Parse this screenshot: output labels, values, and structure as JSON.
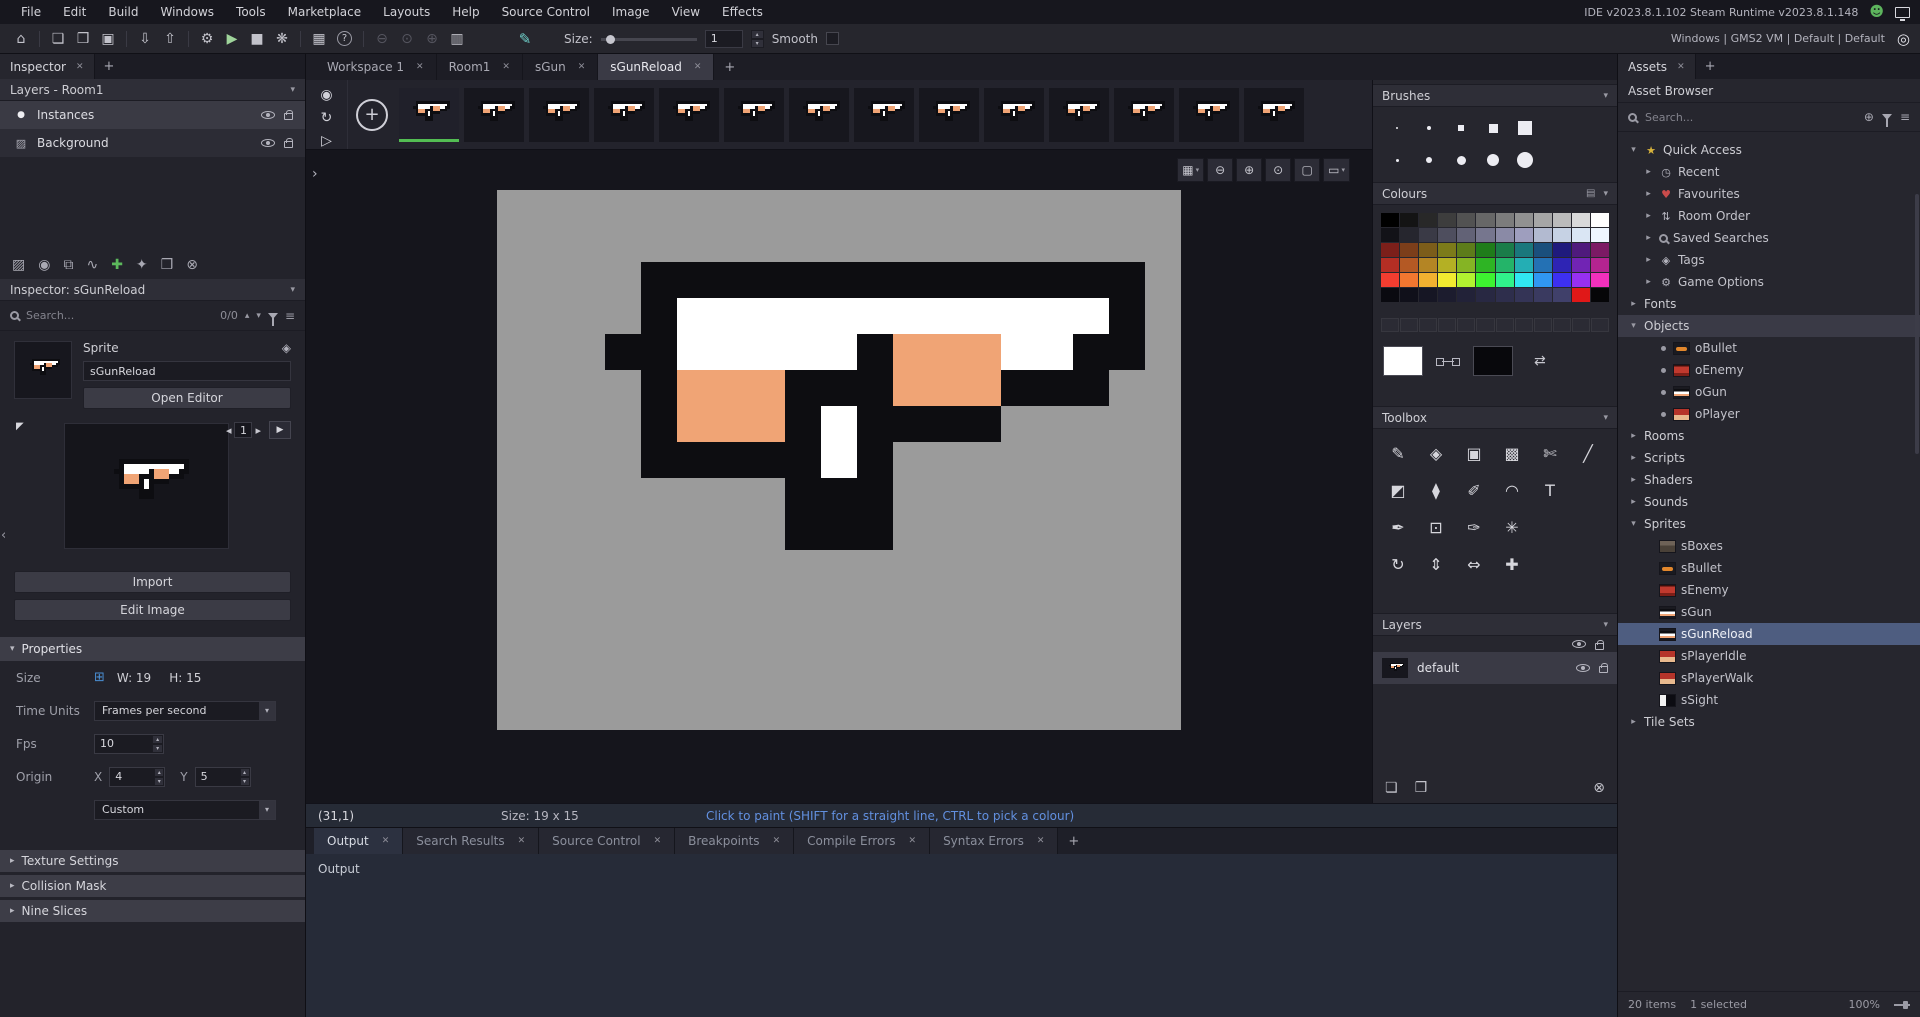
{
  "menubar": {
    "items": [
      "File",
      "Edit",
      "Build",
      "Windows",
      "Tools",
      "Marketplace",
      "Layouts",
      "Help",
      "Source Control",
      "Image",
      "View",
      "Effects"
    ],
    "version_text": "IDE v2023.8.1.102 Steam  Runtime v2023.8.1.148"
  },
  "toolbar": {
    "icon_groups": [
      [
        "home"
      ],
      [
        "new-project",
        "open-project",
        "save-project"
      ],
      [
        "import-package",
        "export-package"
      ],
      [
        "debug",
        "run",
        "stop",
        "clean"
      ],
      [
        "target-manager",
        "help"
      ],
      [
        "zoom-out",
        "zoom-reset",
        "zoom-in",
        "window-layout"
      ]
    ],
    "size_label": "Size:",
    "size_value": "1",
    "smooth_label": "Smooth",
    "platform_text": "Windows | GMS2 VM | Default | Default"
  },
  "inspector": {
    "tab_label": "Inspector",
    "layers_header": "Layers - Room1",
    "room_layers": [
      {
        "name": "Instances",
        "icon": "instance"
      },
      {
        "name": "Background",
        "icon": "background"
      }
    ],
    "icon_row": [
      "image",
      "sphere",
      "layer-stack",
      "path",
      "add",
      "magic",
      "folder",
      "remove"
    ],
    "section_header": "Inspector: sGunReload",
    "search_placeholder": "Search...",
    "search_count": "0/0",
    "sprite_label": "Sprite",
    "sprite_name": "sGunReload",
    "open_editor_label": "Open Editor",
    "frame_number": "1",
    "import_label": "Import",
    "edit_image_label": "Edit Image",
    "properties_header": "Properties",
    "size_label": "Size",
    "size_w": "W: 19",
    "size_h": "H: 15",
    "time_units_label": "Time Units",
    "time_units_value": "Frames per second",
    "fps_label": "Fps",
    "fps_value": "10",
    "origin_label": "Origin",
    "origin_x_label": "X",
    "origin_x_value": "4",
    "origin_y_label": "Y",
    "origin_y_value": "5",
    "origin_preset": "Custom",
    "fold_sections": [
      "Texture Settings",
      "Collision Mask",
      "Nine Slices"
    ]
  },
  "workspace_tabs": [
    {
      "label": "Workspace 1",
      "active": false
    },
    {
      "label": "Room1",
      "active": false
    },
    {
      "label": "sGun",
      "active": false
    },
    {
      "label": "sGunReload",
      "active": true
    }
  ],
  "sprite_editor": {
    "side_tools": [
      "paint",
      "frames",
      "play"
    ],
    "canvas_controls": [
      {
        "name": "grid-options",
        "dropdown": true
      },
      {
        "name": "zoom-out",
        "dropdown": false
      },
      {
        "name": "zoom-in",
        "dropdown": false
      },
      {
        "name": "zoom-reset",
        "dropdown": false
      },
      {
        "name": "fit-view",
        "dropdown": false
      },
      {
        "name": "view-options",
        "dropdown": true
      }
    ],
    "frame_count": 14,
    "status": {
      "coords": "(31,1)",
      "size": "Size: 19 x 15",
      "hint": "Click to paint (SHIFT for a straight line, CTRL to pick a colour)",
      "hint_color": "#6290e0"
    }
  },
  "sprite": {
    "name": "sGunReload",
    "width": 19,
    "height": 15,
    "canvas_bg": "#9b9b9b",
    "colors": {
      "K": "#0d0d11",
      "W": "#ffffff",
      "O": "#f0a475"
    },
    "pixels": [
      "...................",
      "...................",
      "....KKKKKKKKKKKKKK.",
      "....KWWWWWWWWWWWWK.",
      "...KKWWWWWKOOOWWKK.",
      "....KOOOKKKOOOKKK..",
      "....KOOOKWKKKK.....",
      "....KKKKKWK........",
      "........KKK........",
      "........KKK........",
      "...................",
      "...................",
      "...................",
      "...................",
      "..................."
    ]
  },
  "tools_panel": {
    "brushes_header": "Brushes",
    "brushes": [
      [
        {
          "shape": "dot",
          "size": 2
        },
        {
          "shape": "dot",
          "size": 4
        },
        {
          "shape": "square",
          "size": 6
        },
        {
          "shape": "square",
          "size": 9
        },
        {
          "shape": "square",
          "size": 14
        }
      ],
      [
        {
          "shape": "dot",
          "size": 3
        },
        {
          "shape": "circle",
          "size": 6
        },
        {
          "shape": "circle",
          "size": 9
        },
        {
          "shape": "circle",
          "size": 12
        },
        {
          "shape": "circle",
          "size": 16
        }
      ]
    ],
    "colours_header": "Colours",
    "palette": [
      [
        "#000000",
        "#141414",
        "#282828",
        "#3d3d3d",
        "#525252",
        "#676767",
        "#7c7c7c",
        "#919191",
        "#a6a6a6",
        "#bbbbbb",
        "#d9d9d9",
        "#ffffff"
      ],
      [
        "#121218",
        "#26262e",
        "#3a3a46",
        "#4e4e5e",
        "#626276",
        "#76768e",
        "#8a8aa6",
        "#9e9ebe",
        "#b2bad0",
        "#c6d2e4",
        "#dae6f4",
        "#eef6ff"
      ],
      [
        "#7c1f1a",
        "#7c3e1a",
        "#7c5d1a",
        "#7c7b1a",
        "#5d7c1a",
        "#1f7c1a",
        "#1a7c49",
        "#1a777c",
        "#1a4f7c",
        "#1f1a7c",
        "#4f1a7c",
        "#7c1a64"
      ],
      [
        "#b42e24",
        "#b45924",
        "#b48524",
        "#b4b024",
        "#85b424",
        "#2eb424",
        "#24b469",
        "#24aeb4",
        "#2471b4",
        "#2e24b4",
        "#7124b4",
        "#b42490"
      ],
      [
        "#f23d30",
        "#f27730",
        "#f2b130",
        "#f2eb30",
        "#b1f230",
        "#3df230",
        "#30f28b",
        "#30e7f2",
        "#3097f2",
        "#3d30f2",
        "#9730f2",
        "#f230bd"
      ],
      [
        "#0a0a10",
        "#10101a",
        "#161624",
        "#1c1c2e",
        "#222238",
        "#282842",
        "#2e2e4c",
        "#343456",
        "#3a3a60",
        "#40406a",
        "#e01818",
        "#060608"
      ]
    ],
    "empty_swatch_count": 12,
    "primary_colour": "#ffffff",
    "secondary_colour": "#08080c",
    "toolbox_header": "Toolbox",
    "toolbox_rows": [
      [
        "pencil",
        "eraser",
        "brush-copy",
        "brush-paste",
        "brush-cut",
        "line"
      ],
      [
        "fill",
        "ink",
        "paint-brush",
        "curve",
        "text"
      ],
      [
        "eyedropper",
        "select-rect",
        "colour-picker",
        "spray"
      ],
      [
        "rotate",
        "flip-vertical",
        "flip-horizontal",
        "move"
      ]
    ],
    "layers_header": "Layers",
    "layers": [
      {
        "name": "default"
      }
    ]
  },
  "asset_browser": {
    "tab_label": "Assets",
    "title": "Asset Browser",
    "search_placeholder": "Search...",
    "tree": [
      {
        "label": "Quick Access",
        "level": 0,
        "arrow": "down",
        "icon": "star"
      },
      {
        "label": "Recent",
        "level": 1,
        "arrow": "right",
        "icon": "clock"
      },
      {
        "label": "Favourites",
        "level": 1,
        "arrow": "right",
        "icon": "heart"
      },
      {
        "label": "Room Order",
        "level": 1,
        "arrow": "right",
        "icon": "sort"
      },
      {
        "label": "Saved Searches",
        "level": 1,
        "arrow": "right",
        "icon": "search"
      },
      {
        "label": "Tags",
        "level": 1,
        "arrow": "right",
        "icon": "tag"
      },
      {
        "label": "Game Options",
        "level": 1,
        "arrow": "right",
        "icon": "gear"
      },
      {
        "label": "Fonts",
        "level": 0,
        "arrow": "right"
      },
      {
        "label": "Objects",
        "level": 0,
        "arrow": "down",
        "highlight": true
      },
      {
        "label": "oBullet",
        "level": 1,
        "icon": "dot",
        "thumb": "bullet"
      },
      {
        "label": "oEnemy",
        "level": 1,
        "icon": "dot",
        "thumb": "enemy"
      },
      {
        "label": "oGun",
        "level": 1,
        "icon": "dot",
        "thumb": "gun"
      },
      {
        "label": "oPlayer",
        "level": 1,
        "icon": "dot",
        "thumb": "player"
      },
      {
        "label": "Rooms",
        "level": 0,
        "arrow": "right"
      },
      {
        "label": "Scripts",
        "level": 0,
        "arrow": "right"
      },
      {
        "label": "Shaders",
        "level": 0,
        "arrow": "right"
      },
      {
        "label": "Sounds",
        "level": 0,
        "arrow": "right"
      },
      {
        "label": "Sprites",
        "level": 0,
        "arrow": "down"
      },
      {
        "label": "sBoxes",
        "level": 1,
        "thumb": "boxes"
      },
      {
        "label": "sBullet",
        "level": 1,
        "thumb": "bullet"
      },
      {
        "label": "sEnemy",
        "level": 1,
        "thumb": "enemy"
      },
      {
        "label": "sGun",
        "level": 1,
        "thumb": "gun"
      },
      {
        "label": "sGunReload",
        "level": 1,
        "thumb": "gun",
        "selected": true
      },
      {
        "label": "sPlayerIdle",
        "level": 1,
        "thumb": "player"
      },
      {
        "label": "sPlayerWalk",
        "level": 1,
        "thumb": "player"
      },
      {
        "label": "sSight",
        "level": 1,
        "thumb": "sight"
      },
      {
        "label": "Tile Sets",
        "level": 0,
        "arrow": "right"
      }
    ],
    "status_items": "20 items",
    "status_selected": "1 selected",
    "zoom": "100%"
  },
  "output": {
    "tabs": [
      {
        "label": "Output",
        "active": true
      },
      {
        "label": "Search Results",
        "active": false
      },
      {
        "label": "Source Control",
        "active": false
      },
      {
        "label": "Breakpoints",
        "active": false
      },
      {
        "label": "Compile Errors",
        "active": false
      },
      {
        "label": "Syntax Errors",
        "active": false
      }
    ],
    "content": "Output"
  }
}
